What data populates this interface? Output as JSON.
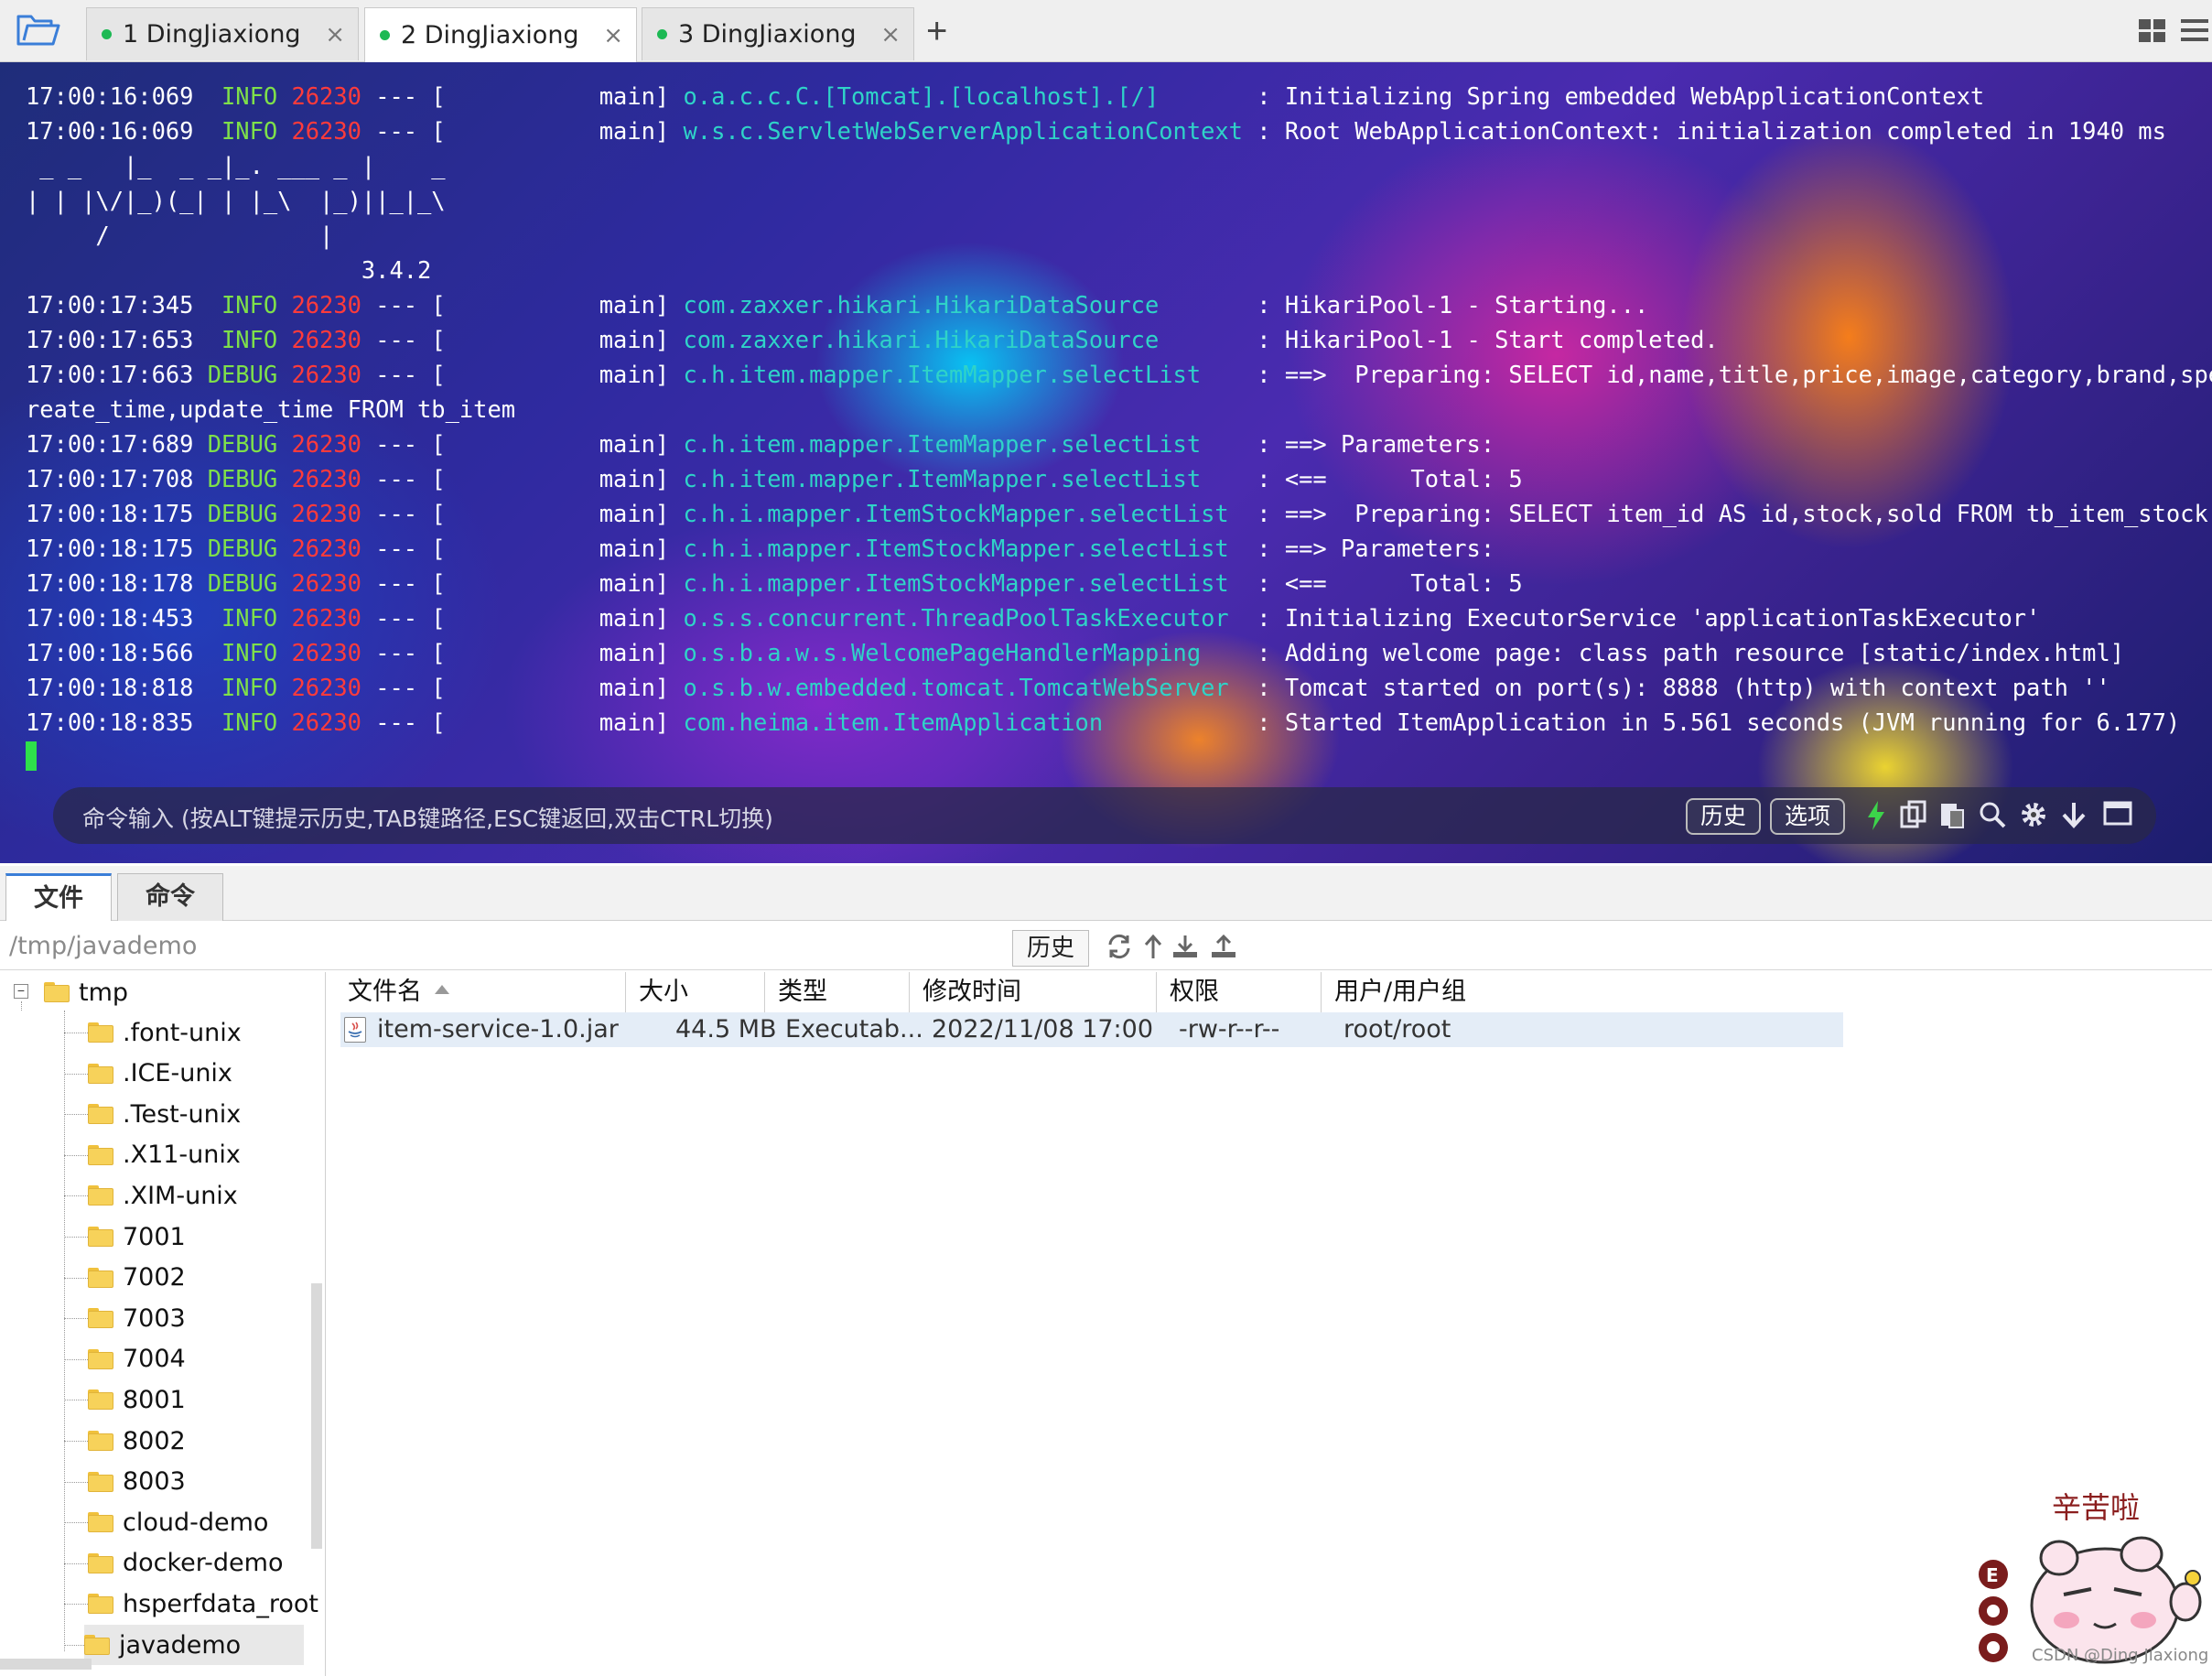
{
  "tabs": [
    {
      "label": "1 DingJiaxiong",
      "status": "connected"
    },
    {
      "label": "2 DingJiaxiong",
      "status": "connected",
      "active": true
    },
    {
      "label": "3 DingJiaxiong",
      "status": "connected"
    }
  ],
  "tab_close": "×",
  "add_tab": "+",
  "terminal": {
    "lines": [
      {
        "time": "17:00:16:069",
        "level": " INFO",
        "pid": "26230",
        "sep": " --- [",
        "thread": "           main]",
        "logger": "o.a.c.c.C.[Tomcat].[localhost].[/]       ",
        "msg": ": Initializing Spring embedded WebApplicationContext"
      },
      {
        "time": "17:00:16:069",
        "level": " INFO",
        "pid": "26230",
        "sep": " --- [",
        "thread": "           main]",
        "logger": "w.s.c.ServletWebServerApplicationContext ",
        "msg": ": Root WebApplicationContext: initialization completed in 1940 ms"
      },
      {
        "plain": " _ _   |_  _ _|_. ___ _ |    _ "
      },
      {
        "plain": "| | |\\/|_)(_| | |_\\  |_)||_|_\\ "
      },
      {
        "plain": "     /               |          "
      },
      {
        "plain": "                        3.4.2"
      },
      {
        "time": "17:00:17:345",
        "level": " INFO",
        "pid": "26230",
        "sep": " --- [",
        "thread": "           main]",
        "logger": "com.zaxxer.hikari.HikariDataSource       ",
        "msg": ": HikariPool-1 - Starting..."
      },
      {
        "time": "17:00:17:653",
        "level": " INFO",
        "pid": "26230",
        "sep": " --- [",
        "thread": "           main]",
        "logger": "com.zaxxer.hikari.HikariDataSource       ",
        "msg": ": HikariPool-1 - Start completed."
      },
      {
        "time": "17:00:17:663",
        "level": "DEBUG",
        "pid": "26230",
        "sep": " --- [",
        "thread": "           main]",
        "logger": "c.h.item.mapper.ItemMapper.selectList    ",
        "msg": ": ==>  Preparing: SELECT id,name,title,price,image,category,brand,spec,status,c"
      },
      {
        "plain": "reate_time,update_time FROM tb_item"
      },
      {
        "time": "17:00:17:689",
        "level": "DEBUG",
        "pid": "26230",
        "sep": " --- [",
        "thread": "           main]",
        "logger": "c.h.item.mapper.ItemMapper.selectList    ",
        "msg": ": ==> Parameters: "
      },
      {
        "time": "17:00:17:708",
        "level": "DEBUG",
        "pid": "26230",
        "sep": " --- [",
        "thread": "           main]",
        "logger": "c.h.item.mapper.ItemMapper.selectList    ",
        "msg": ": <==      Total: 5"
      },
      {
        "time": "17:00:18:175",
        "level": "DEBUG",
        "pid": "26230",
        "sep": " --- [",
        "thread": "           main]",
        "logger": "c.h.i.mapper.ItemStockMapper.selectList  ",
        "msg": ": ==>  Preparing: SELECT item_id AS id,stock,sold FROM tb_item_stock"
      },
      {
        "time": "17:00:18:175",
        "level": "DEBUG",
        "pid": "26230",
        "sep": " --- [",
        "thread": "           main]",
        "logger": "c.h.i.mapper.ItemStockMapper.selectList  ",
        "msg": ": ==> Parameters: "
      },
      {
        "time": "17:00:18:178",
        "level": "DEBUG",
        "pid": "26230",
        "sep": " --- [",
        "thread": "           main]",
        "logger": "c.h.i.mapper.ItemStockMapper.selectList  ",
        "msg": ": <==      Total: 5"
      },
      {
        "time": "17:00:18:453",
        "level": " INFO",
        "pid": "26230",
        "sep": " --- [",
        "thread": "           main]",
        "logger": "o.s.s.concurrent.ThreadPoolTaskExecutor  ",
        "msg": ": Initializing ExecutorService 'applicationTaskExecutor'"
      },
      {
        "time": "17:00:18:566",
        "level": " INFO",
        "pid": "26230",
        "sep": " --- [",
        "thread": "           main]",
        "logger": "o.s.b.a.w.s.WelcomePageHandlerMapping    ",
        "msg": ": Adding welcome page: class path resource [static/index.html]"
      },
      {
        "time": "17:00:18:818",
        "level": " INFO",
        "pid": "26230",
        "sep": " --- [",
        "thread": "           main]",
        "logger": "o.s.b.w.embedded.tomcat.TomcatWebServer  ",
        "msg": ": Tomcat started on port(s): 8888 (http) with context path ''"
      },
      {
        "time": "17:00:18:835",
        "level": " INFO",
        "pid": "26230",
        "sep": " --- [",
        "thread": "           main]",
        "logger": "com.heima.item.ItemApplication           ",
        "msg": ": Started ItemApplication in 5.561 seconds (JVM running for 6.177)"
      }
    ],
    "command_placeholder": "命令输入 (按ALT键提示历史,TAB键路径,ESC键返回,双击CTRL切换)",
    "history_button": "历史",
    "options_button": "选项"
  },
  "lower_tabs": {
    "files": "文件",
    "commands": "命令"
  },
  "path": {
    "value": "/tmp/javademo",
    "history_button": "历史"
  },
  "tree": {
    "root": "tmp",
    "items": [
      ".font-unix",
      ".ICE-unix",
      ".Test-unix",
      ".X11-unix",
      ".XIM-unix",
      "7001",
      "7002",
      "7003",
      "7004",
      "8001",
      "8002",
      "8003",
      "cloud-demo",
      "docker-demo",
      "hsperfdata_root",
      "javademo"
    ],
    "selected": "javademo"
  },
  "file_table": {
    "columns": [
      "文件名",
      "大小",
      "类型",
      "修改时间",
      "权限",
      "用户/用户组"
    ],
    "rows": [
      {
        "name": "item-service-1.0.jar",
        "size": "44.5 MB",
        "type": "Executab...",
        "modified": "2022/11/08 17:00",
        "perms": "-rw-r--r--",
        "owner": "root/root"
      }
    ]
  },
  "sticker": {
    "text": "辛苦啦"
  },
  "watermark": "CSDN @Ding Jiaxiong",
  "colors": {
    "accent": "#3a7ed8",
    "status_dot": "#1db954",
    "log_level": "#7ee04a",
    "pid": "#ff3b3b",
    "logger": "#2fd3c8"
  }
}
